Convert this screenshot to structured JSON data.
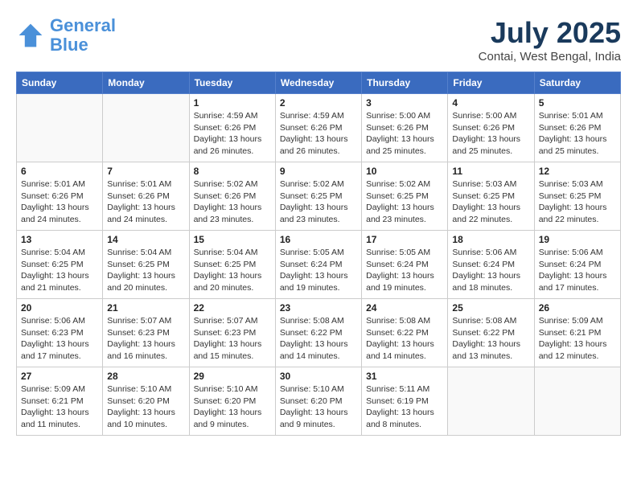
{
  "header": {
    "logo_line1": "General",
    "logo_line2": "Blue",
    "month_title": "July 2025",
    "location": "Contai, West Bengal, India"
  },
  "weekdays": [
    "Sunday",
    "Monday",
    "Tuesday",
    "Wednesday",
    "Thursday",
    "Friday",
    "Saturday"
  ],
  "weeks": [
    [
      {
        "day": "",
        "sunrise": "",
        "sunset": "",
        "daylight": ""
      },
      {
        "day": "",
        "sunrise": "",
        "sunset": "",
        "daylight": ""
      },
      {
        "day": "1",
        "sunrise": "Sunrise: 4:59 AM",
        "sunset": "Sunset: 6:26 PM",
        "daylight": "Daylight: 13 hours and 26 minutes."
      },
      {
        "day": "2",
        "sunrise": "Sunrise: 4:59 AM",
        "sunset": "Sunset: 6:26 PM",
        "daylight": "Daylight: 13 hours and 26 minutes."
      },
      {
        "day": "3",
        "sunrise": "Sunrise: 5:00 AM",
        "sunset": "Sunset: 6:26 PM",
        "daylight": "Daylight: 13 hours and 25 minutes."
      },
      {
        "day": "4",
        "sunrise": "Sunrise: 5:00 AM",
        "sunset": "Sunset: 6:26 PM",
        "daylight": "Daylight: 13 hours and 25 minutes."
      },
      {
        "day": "5",
        "sunrise": "Sunrise: 5:01 AM",
        "sunset": "Sunset: 6:26 PM",
        "daylight": "Daylight: 13 hours and 25 minutes."
      }
    ],
    [
      {
        "day": "6",
        "sunrise": "Sunrise: 5:01 AM",
        "sunset": "Sunset: 6:26 PM",
        "daylight": "Daylight: 13 hours and 24 minutes."
      },
      {
        "day": "7",
        "sunrise": "Sunrise: 5:01 AM",
        "sunset": "Sunset: 6:26 PM",
        "daylight": "Daylight: 13 hours and 24 minutes."
      },
      {
        "day": "8",
        "sunrise": "Sunrise: 5:02 AM",
        "sunset": "Sunset: 6:26 PM",
        "daylight": "Daylight: 13 hours and 23 minutes."
      },
      {
        "day": "9",
        "sunrise": "Sunrise: 5:02 AM",
        "sunset": "Sunset: 6:25 PM",
        "daylight": "Daylight: 13 hours and 23 minutes."
      },
      {
        "day": "10",
        "sunrise": "Sunrise: 5:02 AM",
        "sunset": "Sunset: 6:25 PM",
        "daylight": "Daylight: 13 hours and 23 minutes."
      },
      {
        "day": "11",
        "sunrise": "Sunrise: 5:03 AM",
        "sunset": "Sunset: 6:25 PM",
        "daylight": "Daylight: 13 hours and 22 minutes."
      },
      {
        "day": "12",
        "sunrise": "Sunrise: 5:03 AM",
        "sunset": "Sunset: 6:25 PM",
        "daylight": "Daylight: 13 hours and 22 minutes."
      }
    ],
    [
      {
        "day": "13",
        "sunrise": "Sunrise: 5:04 AM",
        "sunset": "Sunset: 6:25 PM",
        "daylight": "Daylight: 13 hours and 21 minutes."
      },
      {
        "day": "14",
        "sunrise": "Sunrise: 5:04 AM",
        "sunset": "Sunset: 6:25 PM",
        "daylight": "Daylight: 13 hours and 20 minutes."
      },
      {
        "day": "15",
        "sunrise": "Sunrise: 5:04 AM",
        "sunset": "Sunset: 6:25 PM",
        "daylight": "Daylight: 13 hours and 20 minutes."
      },
      {
        "day": "16",
        "sunrise": "Sunrise: 5:05 AM",
        "sunset": "Sunset: 6:24 PM",
        "daylight": "Daylight: 13 hours and 19 minutes."
      },
      {
        "day": "17",
        "sunrise": "Sunrise: 5:05 AM",
        "sunset": "Sunset: 6:24 PM",
        "daylight": "Daylight: 13 hours and 19 minutes."
      },
      {
        "day": "18",
        "sunrise": "Sunrise: 5:06 AM",
        "sunset": "Sunset: 6:24 PM",
        "daylight": "Daylight: 13 hours and 18 minutes."
      },
      {
        "day": "19",
        "sunrise": "Sunrise: 5:06 AM",
        "sunset": "Sunset: 6:24 PM",
        "daylight": "Daylight: 13 hours and 17 minutes."
      }
    ],
    [
      {
        "day": "20",
        "sunrise": "Sunrise: 5:06 AM",
        "sunset": "Sunset: 6:23 PM",
        "daylight": "Daylight: 13 hours and 17 minutes."
      },
      {
        "day": "21",
        "sunrise": "Sunrise: 5:07 AM",
        "sunset": "Sunset: 6:23 PM",
        "daylight": "Daylight: 13 hours and 16 minutes."
      },
      {
        "day": "22",
        "sunrise": "Sunrise: 5:07 AM",
        "sunset": "Sunset: 6:23 PM",
        "daylight": "Daylight: 13 hours and 15 minutes."
      },
      {
        "day": "23",
        "sunrise": "Sunrise: 5:08 AM",
        "sunset": "Sunset: 6:22 PM",
        "daylight": "Daylight: 13 hours and 14 minutes."
      },
      {
        "day": "24",
        "sunrise": "Sunrise: 5:08 AM",
        "sunset": "Sunset: 6:22 PM",
        "daylight": "Daylight: 13 hours and 14 minutes."
      },
      {
        "day": "25",
        "sunrise": "Sunrise: 5:08 AM",
        "sunset": "Sunset: 6:22 PM",
        "daylight": "Daylight: 13 hours and 13 minutes."
      },
      {
        "day": "26",
        "sunrise": "Sunrise: 5:09 AM",
        "sunset": "Sunset: 6:21 PM",
        "daylight": "Daylight: 13 hours and 12 minutes."
      }
    ],
    [
      {
        "day": "27",
        "sunrise": "Sunrise: 5:09 AM",
        "sunset": "Sunset: 6:21 PM",
        "daylight": "Daylight: 13 hours and 11 minutes."
      },
      {
        "day": "28",
        "sunrise": "Sunrise: 5:10 AM",
        "sunset": "Sunset: 6:20 PM",
        "daylight": "Daylight: 13 hours and 10 minutes."
      },
      {
        "day": "29",
        "sunrise": "Sunrise: 5:10 AM",
        "sunset": "Sunset: 6:20 PM",
        "daylight": "Daylight: 13 hours and 9 minutes."
      },
      {
        "day": "30",
        "sunrise": "Sunrise: 5:10 AM",
        "sunset": "Sunset: 6:20 PM",
        "daylight": "Daylight: 13 hours and 9 minutes."
      },
      {
        "day": "31",
        "sunrise": "Sunrise: 5:11 AM",
        "sunset": "Sunset: 6:19 PM",
        "daylight": "Daylight: 13 hours and 8 minutes."
      },
      {
        "day": "",
        "sunrise": "",
        "sunset": "",
        "daylight": ""
      },
      {
        "day": "",
        "sunrise": "",
        "sunset": "",
        "daylight": ""
      }
    ]
  ]
}
